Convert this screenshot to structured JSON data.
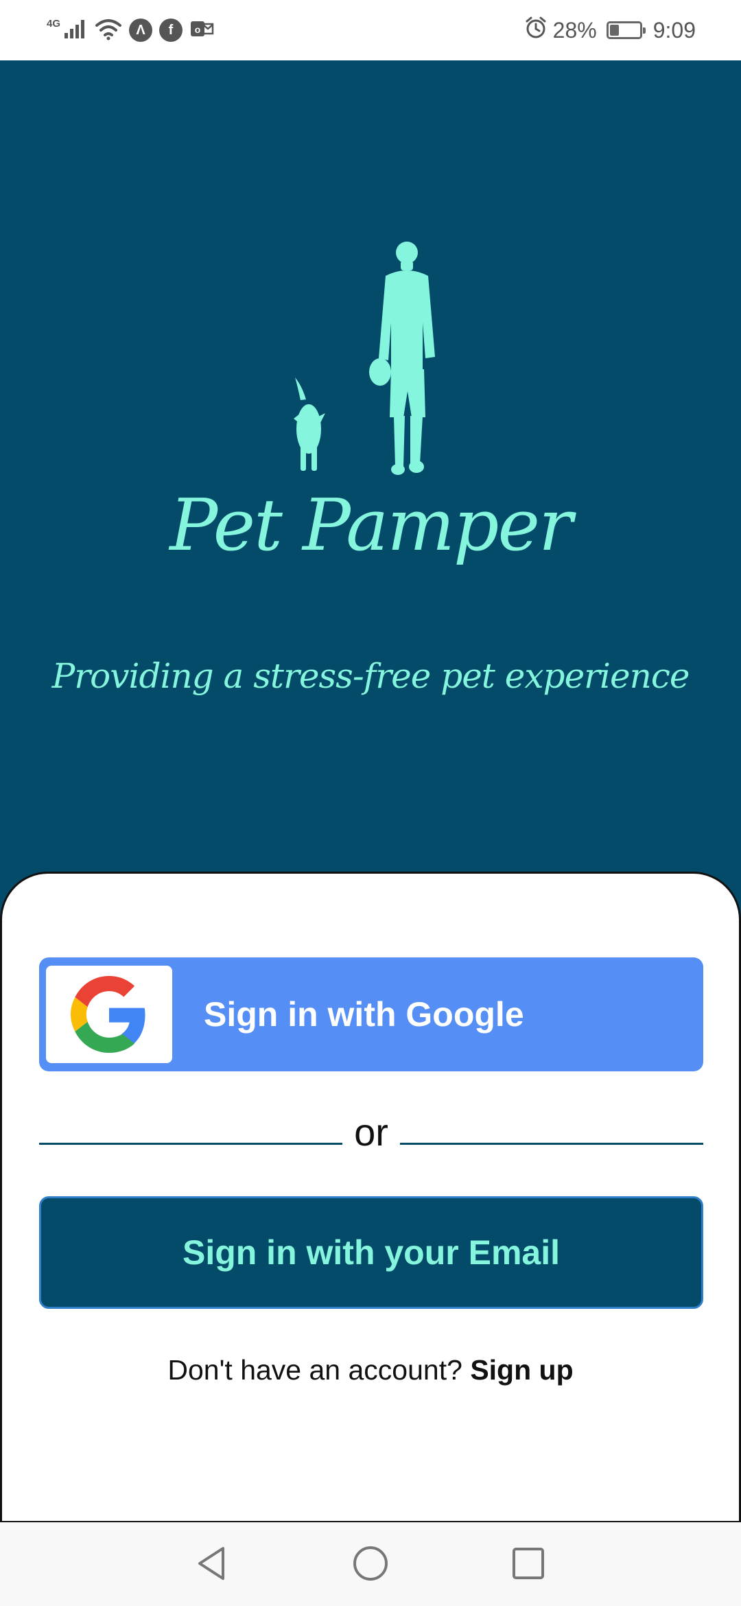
{
  "status_bar": {
    "network_label": "4G",
    "battery_text": "28%",
    "battery_level": 0.28,
    "time": "9:09",
    "icons": [
      "signal-icon",
      "wifi-icon",
      "app-a-icon",
      "facebook-icon",
      "outlook-icon",
      "alarm-icon",
      "battery-icon"
    ]
  },
  "hero": {
    "illustration": "person-walking-dog-illustration",
    "app_name": "Pet Pamper",
    "tagline": "Providing a stress-free pet experience"
  },
  "auth": {
    "google_button_label": "Sign in with Google",
    "divider_text": "or",
    "email_button_label": "Sign in with your Email",
    "no_account_text": "Don't have an account?",
    "signup_link_label": "Sign up"
  },
  "nav_bar": {
    "icons": [
      "back-icon",
      "home-icon",
      "recents-icon"
    ]
  },
  "colors": {
    "primary": "#034b68",
    "accent": "#86f5dd",
    "google_blue": "#558ff5",
    "background": "#ffffff"
  }
}
